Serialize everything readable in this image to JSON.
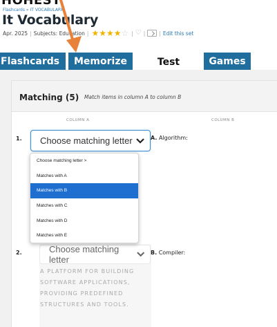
{
  "header": {
    "top_partial_text": "HOHEST",
    "breadcrumb": "Flashcards » IT VOCABULARY",
    "title": "It Vocabulary",
    "date": "Apr. 2025",
    "subjects_label": "Subjects:",
    "subject": "Education",
    "rating_stars": 4.5,
    "edit_link": "Edit this set"
  },
  "tabs": [
    {
      "label": "Flashcards",
      "active": false
    },
    {
      "label": "Memorize",
      "active": false
    },
    {
      "label": "Test",
      "active": true
    },
    {
      "label": "Games",
      "active": false
    }
  ],
  "matching": {
    "title": "Matching (5)",
    "description": "Match items in column A to column B",
    "column_a": "COLUMN A",
    "column_b": "COLUMN B",
    "rows": [
      {
        "number": "1.",
        "select_value": "Choose matching letter",
        "letter": "A.",
        "term": "Algorithm:"
      },
      {
        "number": "2.",
        "select_value": "Choose matching letter",
        "letter": "B.",
        "term": "Compiler:",
        "definition": "A PLATFORM FOR BUILDING SOFTWARE APPLICATIONS, PROVIDING PREDEFINED STRUCTURES AND TOOLS."
      }
    ],
    "dropdown_options": [
      "Choose matching letter >",
      "Matches with A",
      "Matches with B",
      "Matches with C",
      "Matches with D",
      "Matches with E"
    ],
    "selected_option": "Matches with B"
  },
  "colors": {
    "tab_blue": "#1f6e9e",
    "accent_arrow": "#e8823a",
    "selected_option_bg": "#1f6fd1",
    "star_color": "#f0b400"
  }
}
